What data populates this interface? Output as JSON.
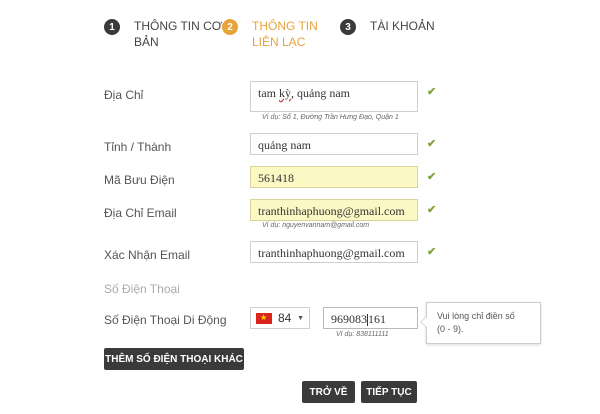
{
  "steps": [
    {
      "number": "1",
      "label_line1": "THÔNG TIN CƠ",
      "label_line2": "BẢN",
      "active": false
    },
    {
      "number": "2",
      "label_line1": "THÔNG TIN",
      "label_line2": "LIÊN LẠC",
      "active": true
    },
    {
      "number": "3",
      "label_line1": "TÀI KHOẢN",
      "label_line2": "",
      "active": false
    }
  ],
  "form": {
    "address": {
      "label": "Địa Chỉ",
      "value_a": "tam ",
      "value_b": "kỳ",
      "value_c": ", quảng nam",
      "hint": "Ví dụ: Số 1, Đường Trần Hưng Đạo, Quận 1"
    },
    "province": {
      "label": "Tỉnh / Thành",
      "value": "quảng nam"
    },
    "postal": {
      "label": "Mã Bưu Điện",
      "value": "561418"
    },
    "email": {
      "label": "Địa Chỉ Email",
      "value": "tranthinhaphuong@gmail.com",
      "hint": "Ví dụ: nguyenvannam@gmail.com"
    },
    "email_confirm": {
      "label": "Xác Nhận Email",
      "value": "tranthinhaphuong@gmail.com"
    },
    "phone_section": {
      "label": "Số Điện Thoại"
    },
    "mobile": {
      "label": "Số Điện Thoại Di Động",
      "country_code": "84",
      "value_before_cursor": "969083",
      "value_after_cursor": "161",
      "hint": "Ví dụ: 838111111"
    }
  },
  "tooltip": {
    "line1": "Vui lòng chỉ điền số",
    "line2": "(0 - 9)."
  },
  "buttons": {
    "add_phone": "THÊM SỐ ĐIỆN THOẠI KHÁC",
    "back": "TRỞ VỀ",
    "continue": "TIẾP TỤC"
  },
  "icons": {
    "check": "check-icon",
    "flag": "vietnam-flag-icon",
    "caret": "caret-down-icon"
  },
  "colors": {
    "active_step": "#e8a33a",
    "check": "#7fa63a",
    "highlight": "#fbf8c4",
    "button": "#3a3a3a"
  }
}
